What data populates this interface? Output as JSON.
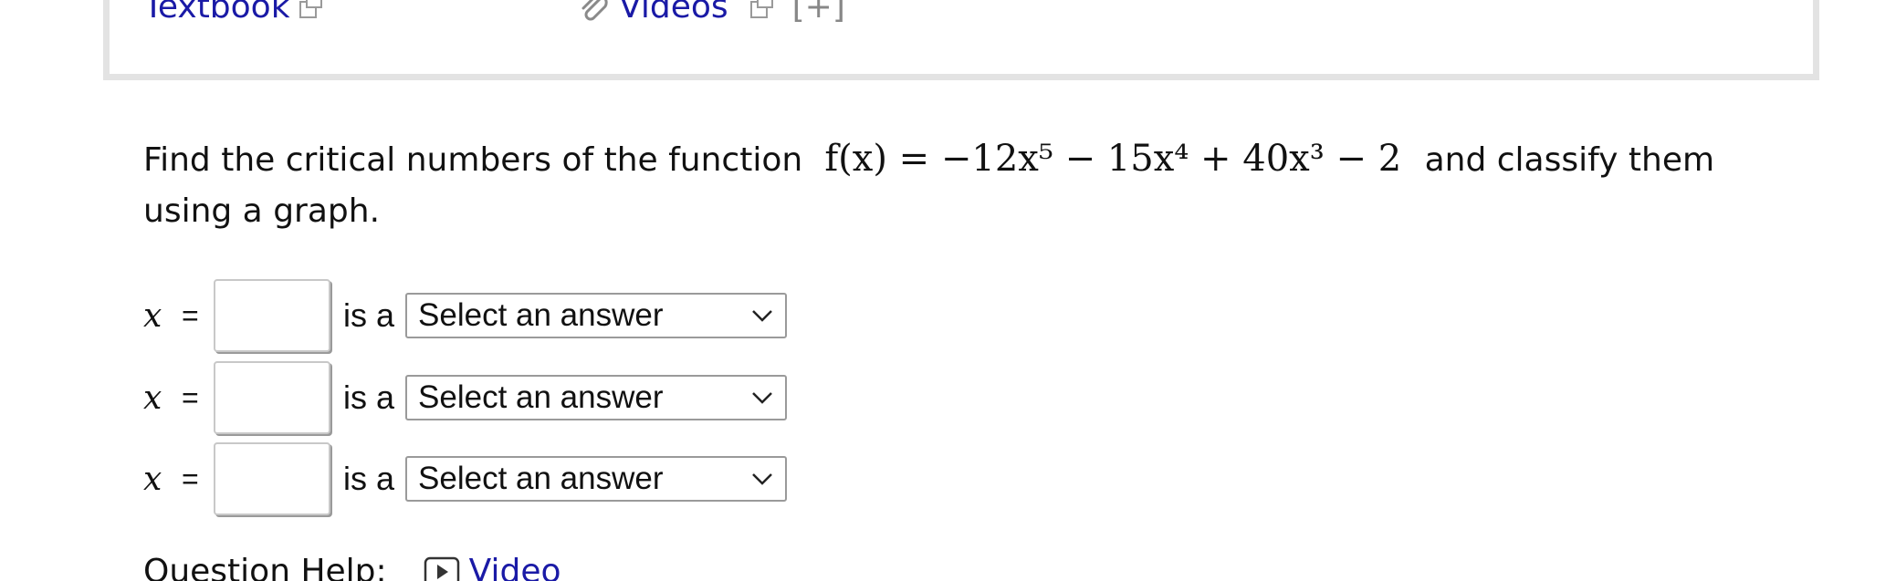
{
  "resources": {
    "textbook_label": "Textbook",
    "videos_label": "Videos",
    "expand_label": "[+]"
  },
  "question": {
    "text_before": "Find the critical numbers of the function",
    "text_after": "and classify them using a graph.",
    "function_lhs": "f(x)",
    "function_rhs": "= −12x⁵ − 15x⁴ + 40x³ − 2"
  },
  "answers": [
    {
      "variable": "x",
      "equals": "=",
      "value": "",
      "connector": "is a",
      "select_value": "Select an answer"
    },
    {
      "variable": "x",
      "equals": "=",
      "value": "",
      "connector": "is a",
      "select_value": "Select an answer"
    },
    {
      "variable": "x",
      "equals": "=",
      "value": "",
      "connector": "is a",
      "select_value": "Select an answer"
    }
  ],
  "help": {
    "label": "Question Help:",
    "video_label": "Video"
  },
  "colors": {
    "link": "#1a1aa6",
    "box_border": "#e3e3e3"
  }
}
